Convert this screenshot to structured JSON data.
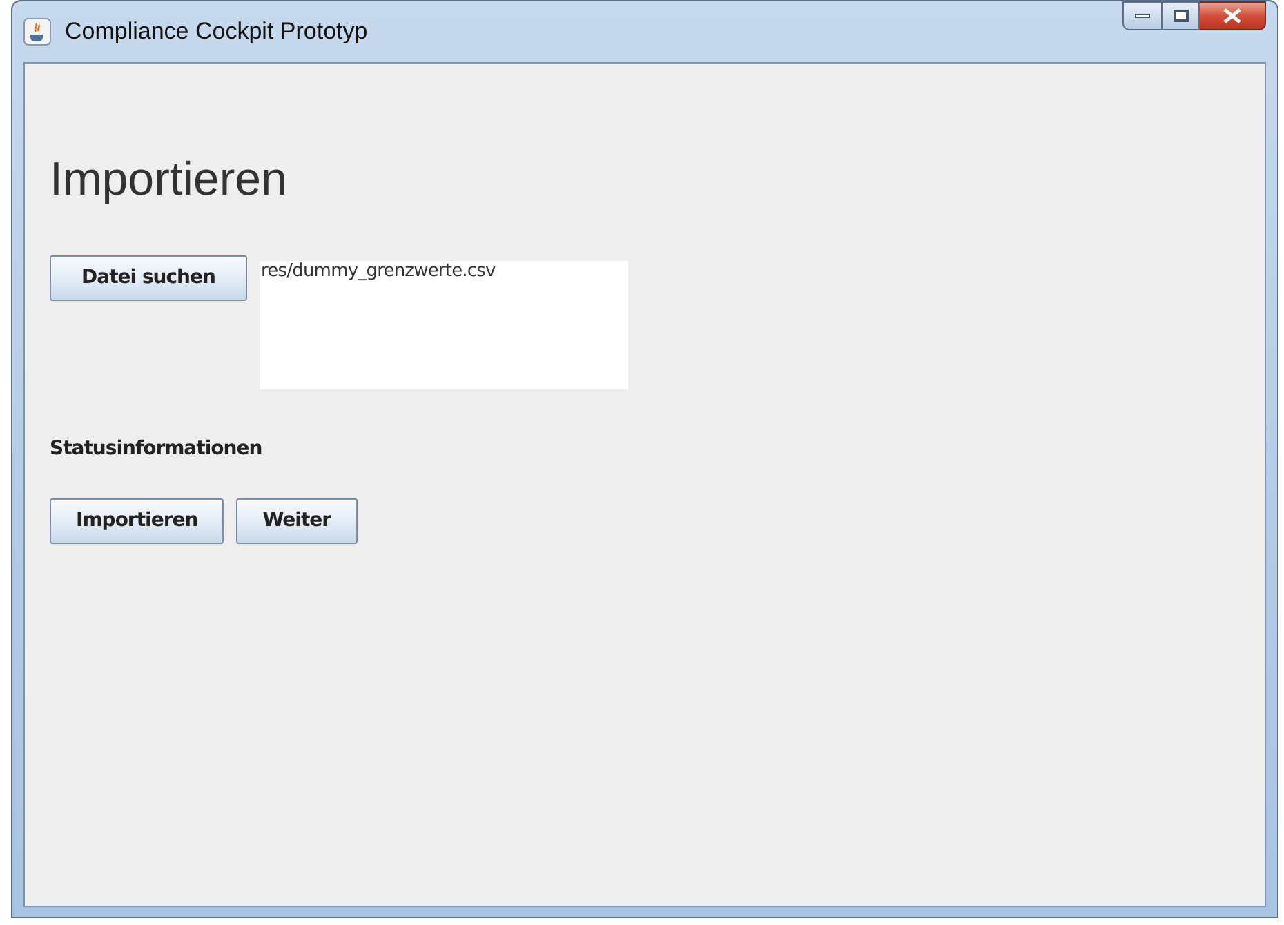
{
  "window": {
    "title": "Compliance Cockpit Prototyp"
  },
  "heading": "Importieren",
  "file_button": "Datei suchen",
  "file_area": {
    "value": "res/dummy_grenzwerte.csv"
  },
  "status_label": "Statusinformationen",
  "buttons": [
    "Importieren",
    "Weiter"
  ]
}
